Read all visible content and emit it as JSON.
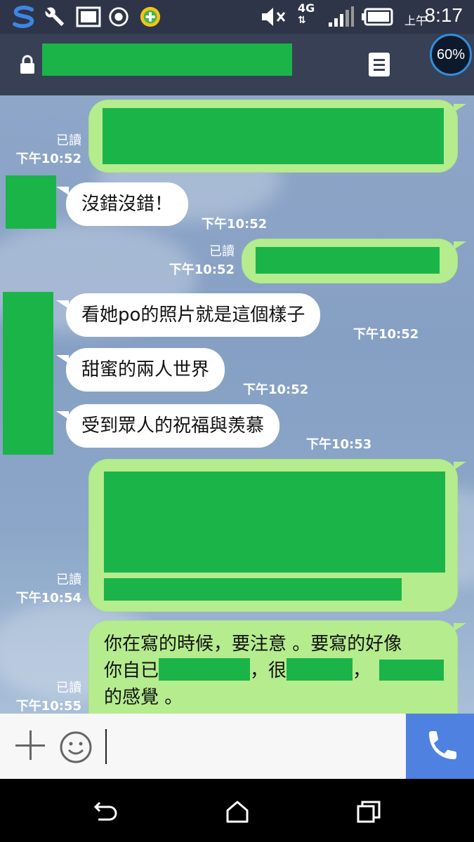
{
  "status_bar": {
    "ampm": "上午",
    "time": "8:17",
    "network": "4G",
    "icons": [
      "s-logo-icon",
      "wrench-icon",
      "image-icon",
      "record-icon",
      "plus-badge-icon",
      "mute-icon",
      "signal-icon",
      "battery-icon"
    ]
  },
  "header": {
    "battery_percent": "60%",
    "icons": [
      "lock-icon",
      "menu-icon"
    ]
  },
  "messages": {
    "m1": {
      "read": "已讀",
      "time": "下午10:52"
    },
    "m2": {
      "text": "沒錯沒錯！",
      "time": "下午10:52"
    },
    "m3": {
      "read": "已讀",
      "time": "下午10:52"
    },
    "m4": {
      "text": "看她po的照片就是這個樣子",
      "time": "下午10:52"
    },
    "m5": {
      "text": "甜蜜的兩人世界",
      "time": "下午10:52"
    },
    "m6": {
      "text": "受到眾人的祝福與羨慕",
      "time": "下午10:53"
    },
    "m7": {
      "read": "已讀",
      "time": "下午10:54"
    },
    "m8": {
      "line1": "你在寫的時候，要注意 。要寫的好像",
      "line2_a": "你自已",
      "line2_b": "，很",
      "line2_c": "，",
      "line3": "的感覺 。",
      "read": "已讀",
      "time": "下午10:55"
    }
  },
  "colors": {
    "outgoing_bubble": "#b5ec8e",
    "incoming_bubble": "#ffffff",
    "redaction": "#1bb449",
    "call_button": "#4f82e0",
    "header": "#374055"
  }
}
